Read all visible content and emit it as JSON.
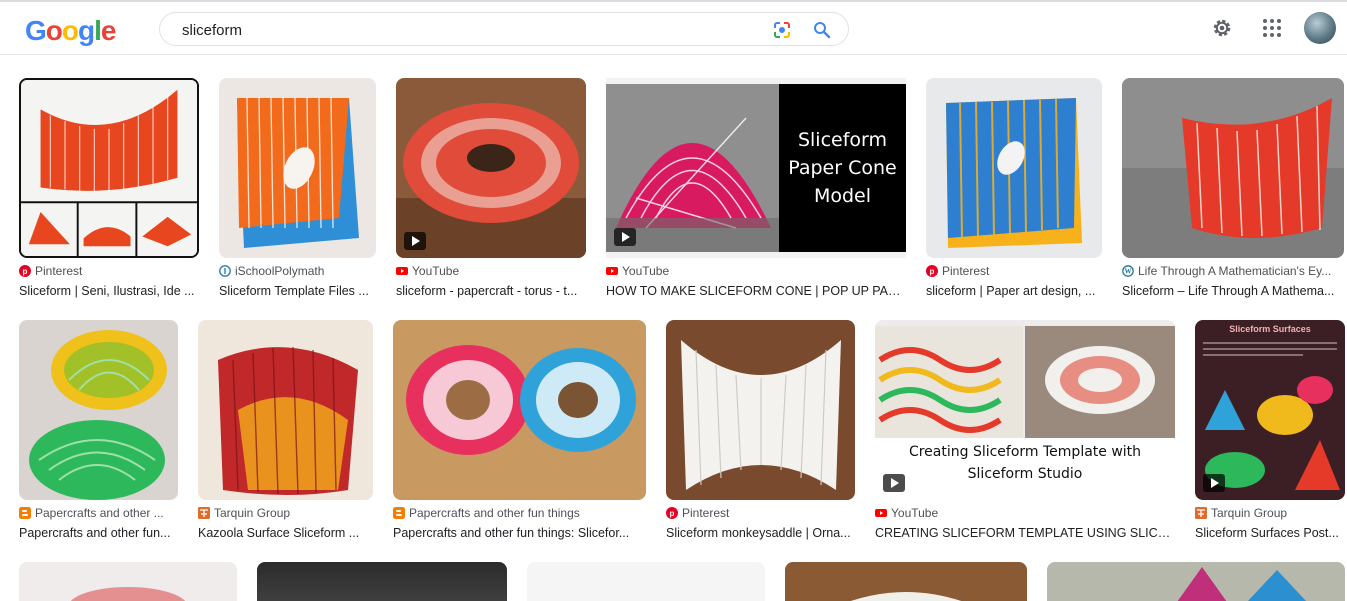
{
  "logo": {
    "letters": [
      "G",
      "o",
      "o",
      "g",
      "l",
      "e"
    ],
    "colors": [
      "#4285f4",
      "#ea4335",
      "#fbbc05",
      "#4285f4",
      "#34a853",
      "#ea4335"
    ]
  },
  "search": {
    "query": "sliceform"
  },
  "icons": {
    "lens": "google-lens-icon",
    "search": "search-icon",
    "settings": "gear-icon",
    "apps": "apps-grid-icon"
  },
  "source_colors": {
    "pinterest": "#e60023",
    "youtube": "#ff0000",
    "blogger": "#f57d00",
    "tarquin": "#e06c2a",
    "ischool": "#2a7fb8",
    "wordpress": "#21759b"
  },
  "row1": [
    {
      "source": "Pinterest",
      "title": "Sliceform | Seni, Ilustrasi, Ide ..."
    },
    {
      "source": "iSchoolPolymath",
      "title": "Sliceform Template Files ..."
    },
    {
      "source": "YouTube",
      "title": "sliceform - papercraft - torus - t..."
    },
    {
      "source": "YouTube",
      "title": "HOW TO MAKE SLICEFORM CONE | POP UP PAPER...",
      "overlay": [
        "Sliceform",
        "Paper Cone",
        "Model"
      ]
    },
    {
      "source": "Pinterest",
      "title": "sliceform | Paper art design, ..."
    },
    {
      "source": "Life Through A Mathematician's Ey...",
      "title": "Sliceform – Life Through A Mathema..."
    }
  ],
  "row2": [
    {
      "source": "Papercrafts and other ...",
      "title": "Papercrafts and other fun..."
    },
    {
      "source": "Tarquin Group",
      "title": "Kazoola Surface Sliceform ..."
    },
    {
      "source": "Papercrafts and other fun things",
      "title": "Papercrafts and other fun things: Slicefor..."
    },
    {
      "source": "Pinterest",
      "title": "Sliceform monkeysaddle | Orna..."
    },
    {
      "source": "YouTube",
      "title": "CREATING SLICEFORM TEMPLATE USING SLICEFO...",
      "overlay": [
        "Creating Sliceform Template with",
        "Sliceform Studio"
      ]
    },
    {
      "source": "Tarquin Group",
      "title": "Sliceform Surfaces Post...",
      "overlay": [
        "Sliceform Surfaces"
      ]
    }
  ]
}
